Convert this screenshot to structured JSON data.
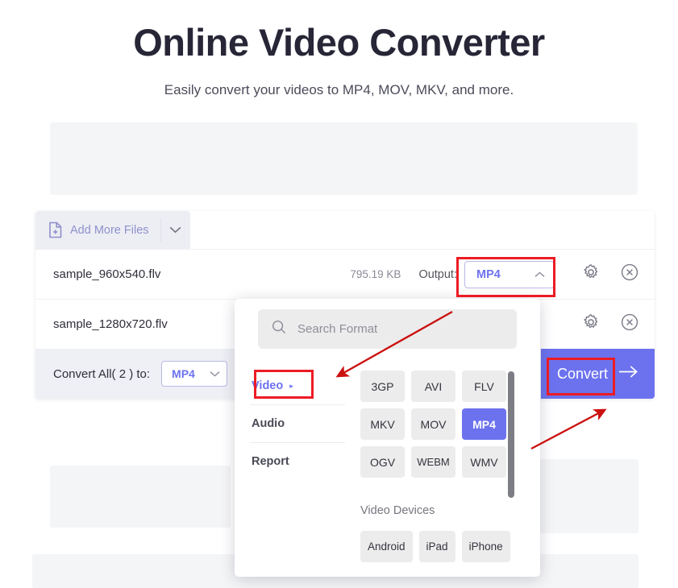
{
  "header": {
    "title": "Online Video Converter",
    "subtitle": "Easily convert your videos to MP4, MOV, MKV, and more."
  },
  "toolbar": {
    "add_files_label": "Add More Files",
    "add_files_icon": "file-plus-icon",
    "caret_icon": "chevron-down-icon"
  },
  "files": [
    {
      "name": "sample_960x540.flv",
      "size": "795.19 KB",
      "output_label": "Output:",
      "output_value": "MP4",
      "output_caret_icon": "chevron-up-icon",
      "settings_icon": "gear-icon",
      "remove_icon": "close-circle-icon"
    },
    {
      "name": "sample_1280x720.flv",
      "size": "",
      "output_label": "",
      "output_value": "",
      "settings_icon": "gear-icon",
      "remove_icon": "close-circle-icon"
    }
  ],
  "convert_all": {
    "label": "Convert All( 2 ) to:",
    "value": "MP4",
    "caret_icon": "chevron-down-icon",
    "button_label": "Convert",
    "button_icon": "arrow-right-icon"
  },
  "format_dropdown": {
    "search_placeholder": "Search Format",
    "search_value": "",
    "search_icon": "search-icon",
    "categories": [
      {
        "label": "Video",
        "active": true,
        "arrow": "▸"
      },
      {
        "label": "Audio",
        "active": false,
        "arrow": ""
      },
      {
        "label": "Report",
        "active": false,
        "arrow": ""
      }
    ],
    "formats": [
      {
        "label": "3GP",
        "selected": false
      },
      {
        "label": "AVI",
        "selected": false
      },
      {
        "label": "FLV",
        "selected": false
      },
      {
        "label": "MKV",
        "selected": false
      },
      {
        "label": "MOV",
        "selected": false
      },
      {
        "label": "MP4",
        "selected": true
      },
      {
        "label": "OGV",
        "selected": false
      },
      {
        "label": "WEBM",
        "selected": false
      },
      {
        "label": "WMV",
        "selected": false
      }
    ],
    "devices_title": "Video Devices",
    "devices": [
      {
        "label": "Android"
      },
      {
        "label": "iPad"
      },
      {
        "label": "iPhone"
      }
    ]
  },
  "colors": {
    "accent": "#6c72ee",
    "annotation": "#ec1c24",
    "panel": "#f4f5f6",
    "toolbar": "#eceef3"
  }
}
